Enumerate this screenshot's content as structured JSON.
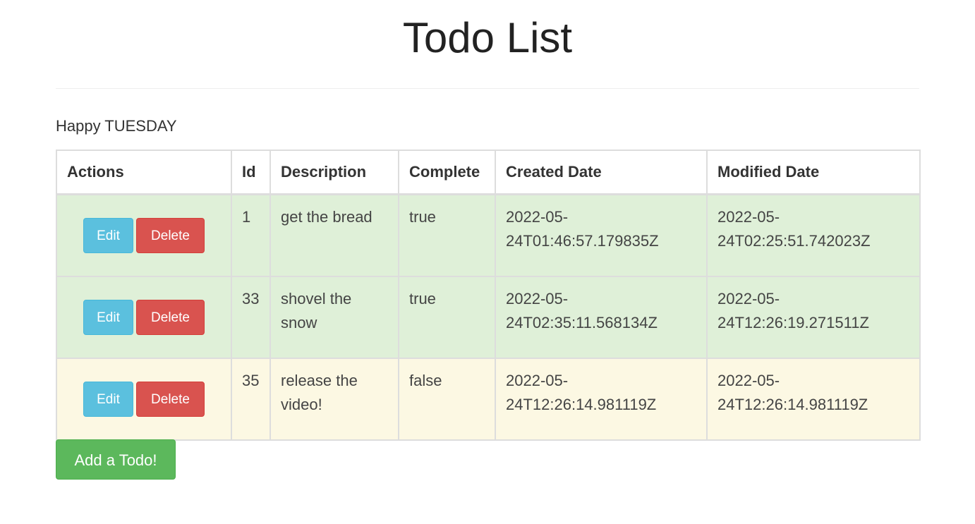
{
  "page": {
    "title": "Todo List",
    "greeting": "Happy TUESDAY"
  },
  "table": {
    "headers": [
      "Actions",
      "Id",
      "Description",
      "Complete",
      "Created Date",
      "Modified Date"
    ],
    "rows": [
      {
        "status": "success",
        "id": "1",
        "description": "get the bread",
        "complete": "true",
        "created_date": "2022-05-24T01:46:57.179835Z",
        "modified_date": "2022-05-24T02:25:51.742023Z"
      },
      {
        "status": "success",
        "id": "33",
        "description": "shovel the snow",
        "complete": "true",
        "created_date": "2022-05-24T02:35:11.568134Z",
        "modified_date": "2022-05-24T12:26:19.271511Z"
      },
      {
        "status": "warning",
        "id": "35",
        "description": "release the video!",
        "complete": "false",
        "created_date": "2022-05-24T12:26:14.981119Z",
        "modified_date": "2022-05-24T12:26:14.981119Z"
      }
    ]
  },
  "buttons": {
    "edit_label": "Edit",
    "delete_label": "Delete",
    "add_label": "Add a Todo!"
  },
  "colors": {
    "edit": "#5bc0de",
    "delete": "#d9534f",
    "add": "#5cb85c",
    "row_complete": "#dff0d8",
    "row_incomplete": "#fcf8e3"
  }
}
